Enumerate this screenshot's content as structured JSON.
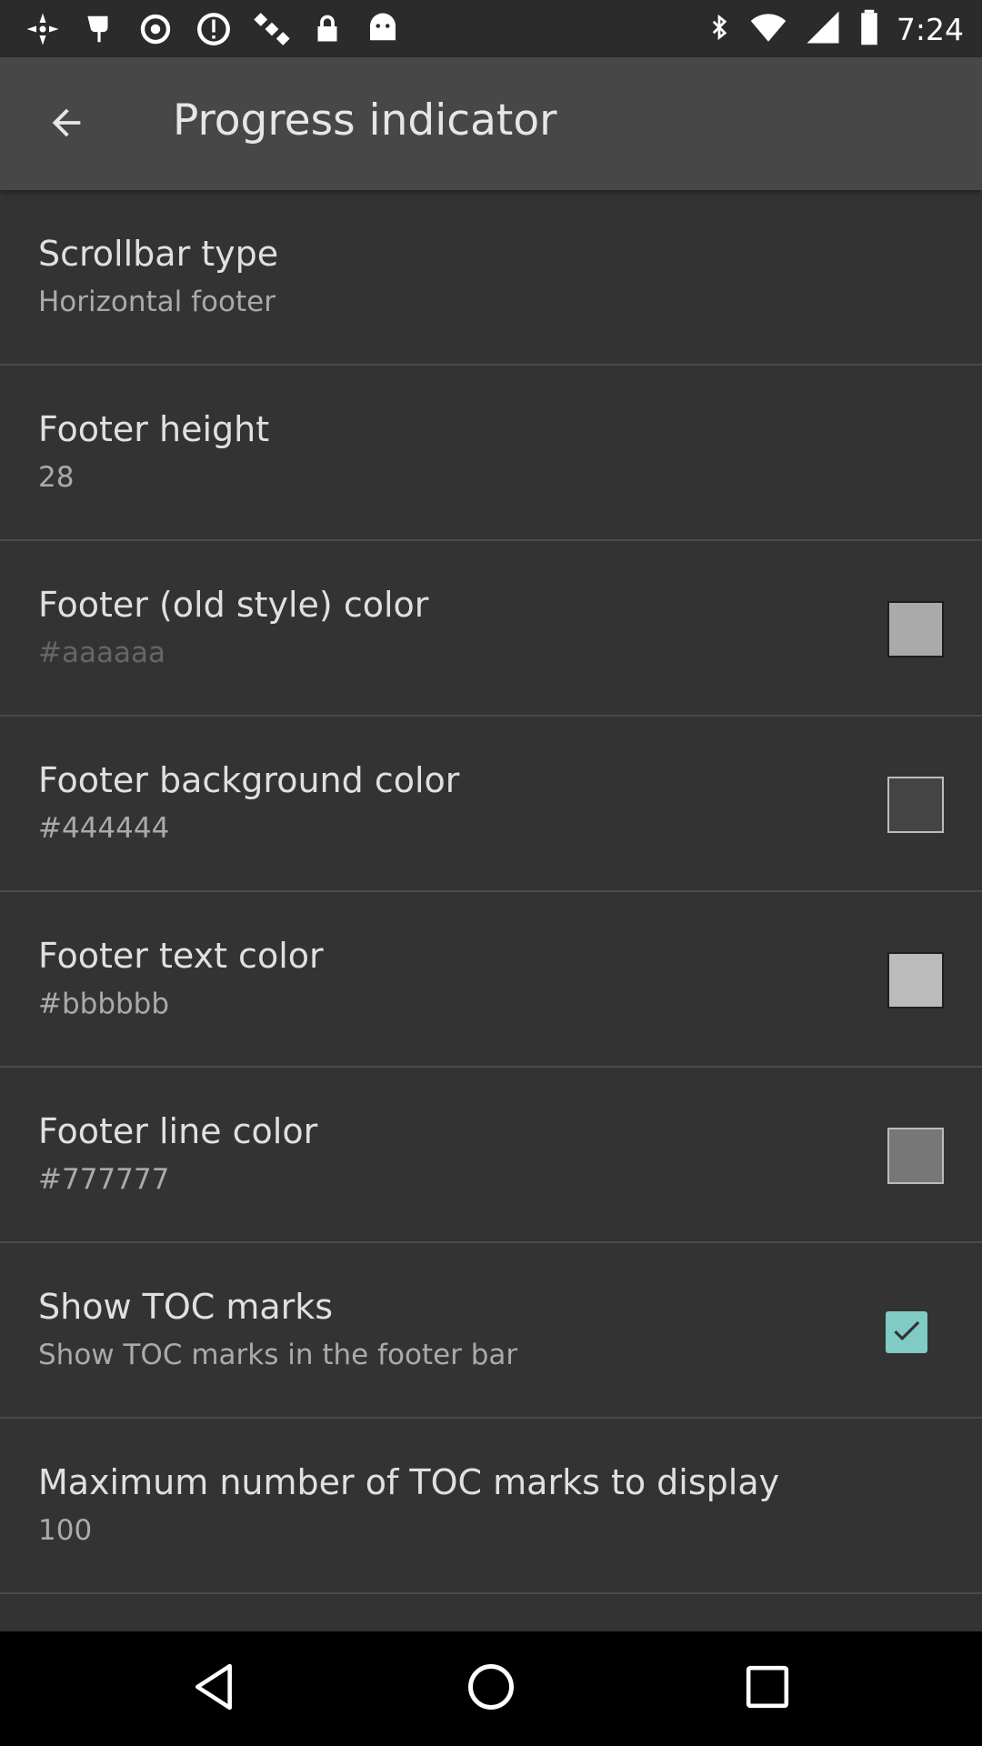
{
  "status_bar": {
    "time": "7:24"
  },
  "app_bar": {
    "title": "Progress indicator",
    "back_icon": "arrow-back-icon"
  },
  "settings": [
    {
      "id": "scrollbar-type",
      "title": "Scrollbar type",
      "summary": "Horizontal footer"
    },
    {
      "id": "footer-height",
      "title": "Footer height",
      "summary": "28"
    },
    {
      "id": "footer-old-style-color",
      "title": "Footer (old style) color",
      "summary": "#aaaaaa",
      "swatch_color": "#aaaaaa"
    },
    {
      "id": "footer-background-color",
      "title": "Footer background color",
      "summary": "#444444",
      "swatch_color": "#444444"
    },
    {
      "id": "footer-text-color",
      "title": "Footer text color",
      "summary": "#bbbbbb",
      "swatch_color": "#bbbbbb"
    },
    {
      "id": "footer-line-color",
      "title": "Footer line color",
      "summary": "#777777",
      "swatch_color": "#777777"
    },
    {
      "id": "show-toc-marks",
      "title": "Show TOC marks",
      "summary": "Show TOC marks in the footer bar",
      "checked": true
    },
    {
      "id": "max-toc-marks",
      "title": "Maximum number of TOC marks to display",
      "summary": "100"
    }
  ],
  "colors": {
    "background": "#333333",
    "app_bar": "#474747",
    "accent": "#80cbc4"
  },
  "nav_bar": {
    "back_icon": "nav-back-icon",
    "home_icon": "nav-home-icon",
    "recents_icon": "nav-recents-icon"
  }
}
